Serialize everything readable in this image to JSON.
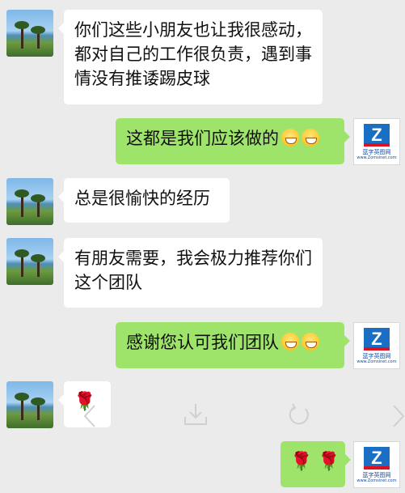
{
  "messages": [
    {
      "side": "left",
      "text": "你们这些小朋友也让我很感动，都对自己的工作很负责，遇到事情没有推诿踢皮球"
    },
    {
      "side": "right",
      "text": "这都是我们应该做的",
      "emoji_count": 2
    },
    {
      "side": "left",
      "text": "总是很愉快的经历"
    },
    {
      "side": "left",
      "text": "有朋友需要，我会极力推荐你们这个团队"
    },
    {
      "side": "right",
      "text": "感谢您认可我们团队",
      "emoji_count": 2
    },
    {
      "side": "left",
      "text": "🌹"
    },
    {
      "side": "right",
      "text": "🌹 🌹"
    }
  ],
  "right_avatar": {
    "logo_letter": "Z",
    "name": "蓝字英图网",
    "url": "www.Zomsinet.com",
    "brand_color": "#1a6fc4"
  },
  "colors": {
    "background": "#ebebeb",
    "incoming_bubble": "#ffffff",
    "outgoing_bubble": "#9fe46a"
  },
  "overlay_icons": [
    "chevron-left-icon",
    "download-icon",
    "rotate-icon",
    "chevron-right-icon"
  ]
}
